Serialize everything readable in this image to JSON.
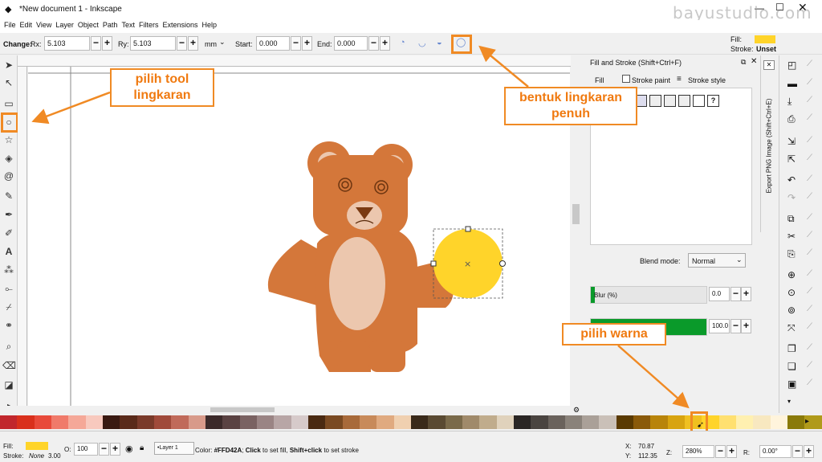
{
  "window": {
    "title": "*New document 1 - Inkscape",
    "watermark": "bayustudio.com"
  },
  "menu": [
    "File",
    "Edit",
    "View",
    "Layer",
    "Object",
    "Path",
    "Text",
    "Filters",
    "Extensions",
    "Help"
  ],
  "toolctrl": {
    "change_label": "Change:",
    "rx_label": "Rx:",
    "rx_value": "5.103",
    "ry_label": "Ry:",
    "ry_value": "5.103",
    "unit": "mm",
    "start_label": "Start:",
    "start_value": "0.000",
    "end_label": "End:",
    "end_value": "0.000",
    "fill_label": "Fill:",
    "stroke_label": "Stroke:",
    "stroke_value": "Unset",
    "fill_color": "#FFD42A"
  },
  "panel": {
    "title": "Fill and Stroke (Shift+Ctrl+F)",
    "tab_fill": "Fill",
    "tab_stroke_paint": "Stroke paint",
    "tab_stroke_style": "Stroke style",
    "help_glyph": "?",
    "blend_label": "Blend mode:",
    "blend_value": "Normal",
    "blur_label": "Blur (%)",
    "blur_value": "0.0",
    "opacity_value": "100.0",
    "opacity_fraction": 1.0
  },
  "export_tab": "Export PNG Image (Shift+Ctrl+E)",
  "annotations": {
    "tool": "pilih tool lingkaran",
    "shape": "bentuk lingkaran penuh",
    "color": "pilih warna"
  },
  "tooltip": "#FFD42A",
  "status": {
    "fill_label": "Fill:",
    "stroke_label": "Stroke:",
    "stroke_value": "None",
    "stroke_width": "3.00",
    "opacity_label": "O:",
    "opacity_value": "100",
    "layer": "•Layer 1",
    "message_prefix": "Color: ",
    "message_color": "#FFD42A",
    "message_mid": "; ",
    "message_click": "Click",
    "message_after_click": " to set fill, ",
    "message_shift": "Shift+click",
    "message_after_shift": " to set stroke",
    "x_label": "X:",
    "x_value": "70.87",
    "y_label": "Y:",
    "y_value": "112.35",
    "z_label": "Z:",
    "zoom_value": "280%",
    "r_label": "R:",
    "rotation_value": "0.00°"
  },
  "colors": {
    "accent": "#f08a24",
    "bear_body": "#d4773a",
    "bear_belly": "#ecc7ae",
    "selected": "#FFD42A",
    "opacity_bar": "#0a9a2a"
  },
  "palette": [
    "#c1272d",
    "#d9301c",
    "#e84a3a",
    "#f07a6a",
    "#f5a898",
    "#f8c9be",
    "#3a1a12",
    "#5a2a1a",
    "#7a3a2a",
    "#a04a3a",
    "#c06a5a",
    "#d89a8a",
    "#3c2a2a",
    "#5a4242",
    "#7a6262",
    "#9a8484",
    "#b8a6a6",
    "#d6caca",
    "#4a2a12",
    "#7a4a22",
    "#a86a3a",
    "#c88a5a",
    "#e0aa80",
    "#f0d0b0",
    "#3a2a1a",
    "#5a4a32",
    "#7a6a4a",
    "#a08a6a",
    "#c0ac8c",
    "#e0d2bc",
    "#2a2624",
    "#4a4440",
    "#6a625c",
    "#8a827a",
    "#aaa098",
    "#cac0b8",
    "#5a3a02",
    "#8a5a0a",
    "#b8840a",
    "#d8a410",
    "#f0c020",
    "#FFD42A",
    "#ffe070",
    "#fff0b0",
    "#f8e8c0",
    "#fff4dc",
    "#8a7a0a",
    "#b09a1a"
  ],
  "tools": [
    "select-icon",
    "node-icon",
    "rect-icon",
    "circle-icon",
    "star-icon",
    "box3d-icon",
    "spiral-icon",
    "pencil-icon",
    "pen-icon",
    "calligraphy-icon",
    "text-icon",
    "spray-icon",
    "connector-icon",
    "dropper-icon",
    "tweak-icon",
    "zoom-icon",
    "eraser-icon",
    "bucket-icon"
  ]
}
